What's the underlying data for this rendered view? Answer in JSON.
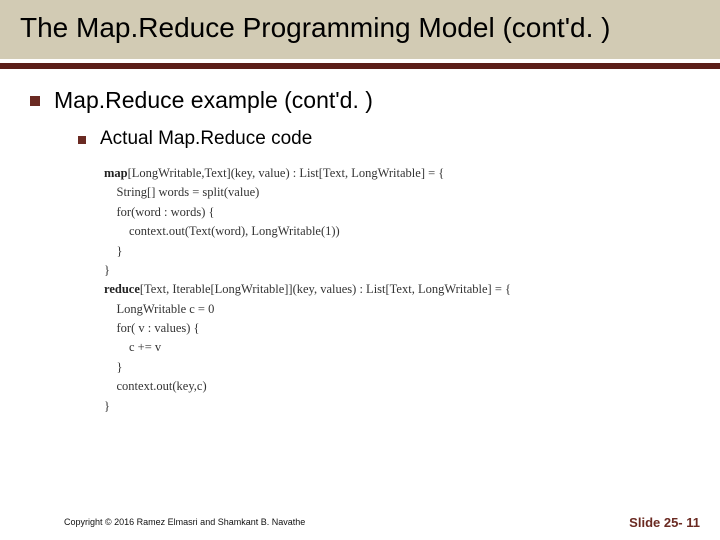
{
  "title": "The Map.Reduce Programming Model (cont'd. )",
  "bullets": {
    "lvl1": "Map.Reduce example (cont'd. )",
    "lvl2": "Actual Map.Reduce code"
  },
  "code": {
    "l1a": "map",
    "l1b": "[LongWritable,Text](key, value) : List[Text, LongWritable] = {",
    "l2": "    String[] words = split(value)",
    "l3": "    for(word : words) {",
    "l4": "        context.out(Text(word), LongWritable(1))",
    "l5": "    }",
    "l6": "}",
    "l7a": "reduce",
    "l7b": "[Text, Iterable[LongWritable]](key, values) : List[Text, LongWritable] = {",
    "l8": "    LongWritable c = 0",
    "l9": "    for( v : values) {",
    "l10": "        c += v",
    "l11": "    }",
    "l12": "    context.out(key,c)",
    "l13": "}"
  },
  "footer": {
    "copyright": "Copyright © 2016 Ramez Elmasri and Shamkant B. Navathe",
    "slide_num": "Slide 25- 11"
  },
  "colors": {
    "title_band": "#d2cbb4",
    "accent": "#5b1e18",
    "bullet": "#6a2a22"
  }
}
